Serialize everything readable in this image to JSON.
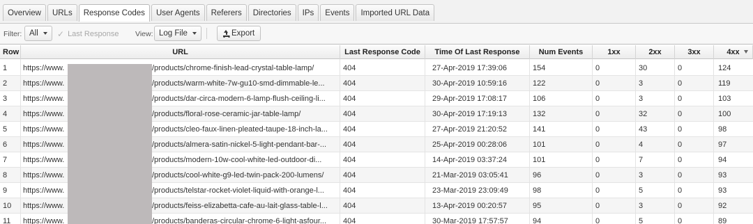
{
  "tabs": [
    "Overview",
    "URLs",
    "Response Codes",
    "User Agents",
    "Referers",
    "Directories",
    "IPs",
    "Events",
    "Imported URL Data"
  ],
  "active_tab": "Response Codes",
  "toolbar": {
    "filter_label": "Filter:",
    "filter_value": "All",
    "last_response_label": "Last Response",
    "view_label": "View:",
    "view_value": "Log File",
    "export_label": "Export"
  },
  "table": {
    "columns": [
      "Row",
      "URL",
      "Last Response Code",
      "Time Of Last Response",
      "Num Events",
      "1xx",
      "2xx",
      "3xx",
      "4xx"
    ],
    "sorted_column": "4xx",
    "sort_direction": "descending",
    "rows": [
      {
        "row": "1",
        "prefix": "https://www.",
        "path": "/products/chrome-finish-lead-crystal-table-lamp/",
        "code": "404",
        "time": "27-Apr-2019 17:39:06",
        "events": "154",
        "c1": "0",
        "c2": "30",
        "c3": "0",
        "c4": "124"
      },
      {
        "row": "2",
        "prefix": "https://www.",
        "path": "/products/warm-white-7w-gu10-smd-dimmable-le...",
        "code": "404",
        "time": "30-Apr-2019 10:59:16",
        "events": "122",
        "c1": "0",
        "c2": "3",
        "c3": "0",
        "c4": "119"
      },
      {
        "row": "3",
        "prefix": "https://www.",
        "path": "/products/dar-circa-modern-6-lamp-flush-ceiling-li...",
        "code": "404",
        "time": "29-Apr-2019 17:08:17",
        "events": "106",
        "c1": "0",
        "c2": "3",
        "c3": "0",
        "c4": "103"
      },
      {
        "row": "4",
        "prefix": "https://www.",
        "path": "/products/floral-rose-ceramic-jar-table-lamp/",
        "code": "404",
        "time": "30-Apr-2019 17:19:13",
        "events": "132",
        "c1": "0",
        "c2": "32",
        "c3": "0",
        "c4": "100"
      },
      {
        "row": "5",
        "prefix": "https://www.",
        "path": "/products/cleo-faux-linen-pleated-taupe-18-inch-la...",
        "code": "404",
        "time": "27-Apr-2019 21:20:52",
        "events": "141",
        "c1": "0",
        "c2": "43",
        "c3": "0",
        "c4": "98"
      },
      {
        "row": "6",
        "prefix": "https://www.",
        "path": "/products/almera-satin-nickel-5-light-pendant-bar-...",
        "code": "404",
        "time": "25-Apr-2019 00:28:06",
        "events": "101",
        "c1": "0",
        "c2": "4",
        "c3": "0",
        "c4": "97"
      },
      {
        "row": "7",
        "prefix": "https://www.",
        "path": "/products/modern-10w-cool-white-led-outdoor-di...",
        "code": "404",
        "time": "14-Apr-2019 03:37:24",
        "events": "101",
        "c1": "0",
        "c2": "7",
        "c3": "0",
        "c4": "94"
      },
      {
        "row": "8",
        "prefix": "https://www.",
        "path": "/products/cool-white-g9-led-twin-pack-200-lumens/",
        "code": "404",
        "time": "21-Mar-2019 03:05:41",
        "events": "96",
        "c1": "0",
        "c2": "3",
        "c3": "0",
        "c4": "93"
      },
      {
        "row": "9",
        "prefix": "https://www.",
        "path": "/products/telstar-rocket-violet-liquid-with-orange-l...",
        "code": "404",
        "time": "23-Mar-2019 23:09:49",
        "events": "98",
        "c1": "0",
        "c2": "5",
        "c3": "0",
        "c4": "93"
      },
      {
        "row": "10",
        "prefix": "https://www.",
        "path": "/products/feiss-elizabetta-cafe-au-lait-glass-table-l...",
        "code": "404",
        "time": "13-Apr-2019 00:20:57",
        "events": "95",
        "c1": "0",
        "c2": "3",
        "c3": "0",
        "c4": "92"
      },
      {
        "row": "11",
        "prefix": "https://www.",
        "path": "/products/banderas-circular-chrome-6-light-asfour...",
        "code": "404",
        "time": "30-Mar-2019 17:57:57",
        "events": "94",
        "c1": "0",
        "c2": "5",
        "c3": "0",
        "c4": "89"
      }
    ]
  }
}
